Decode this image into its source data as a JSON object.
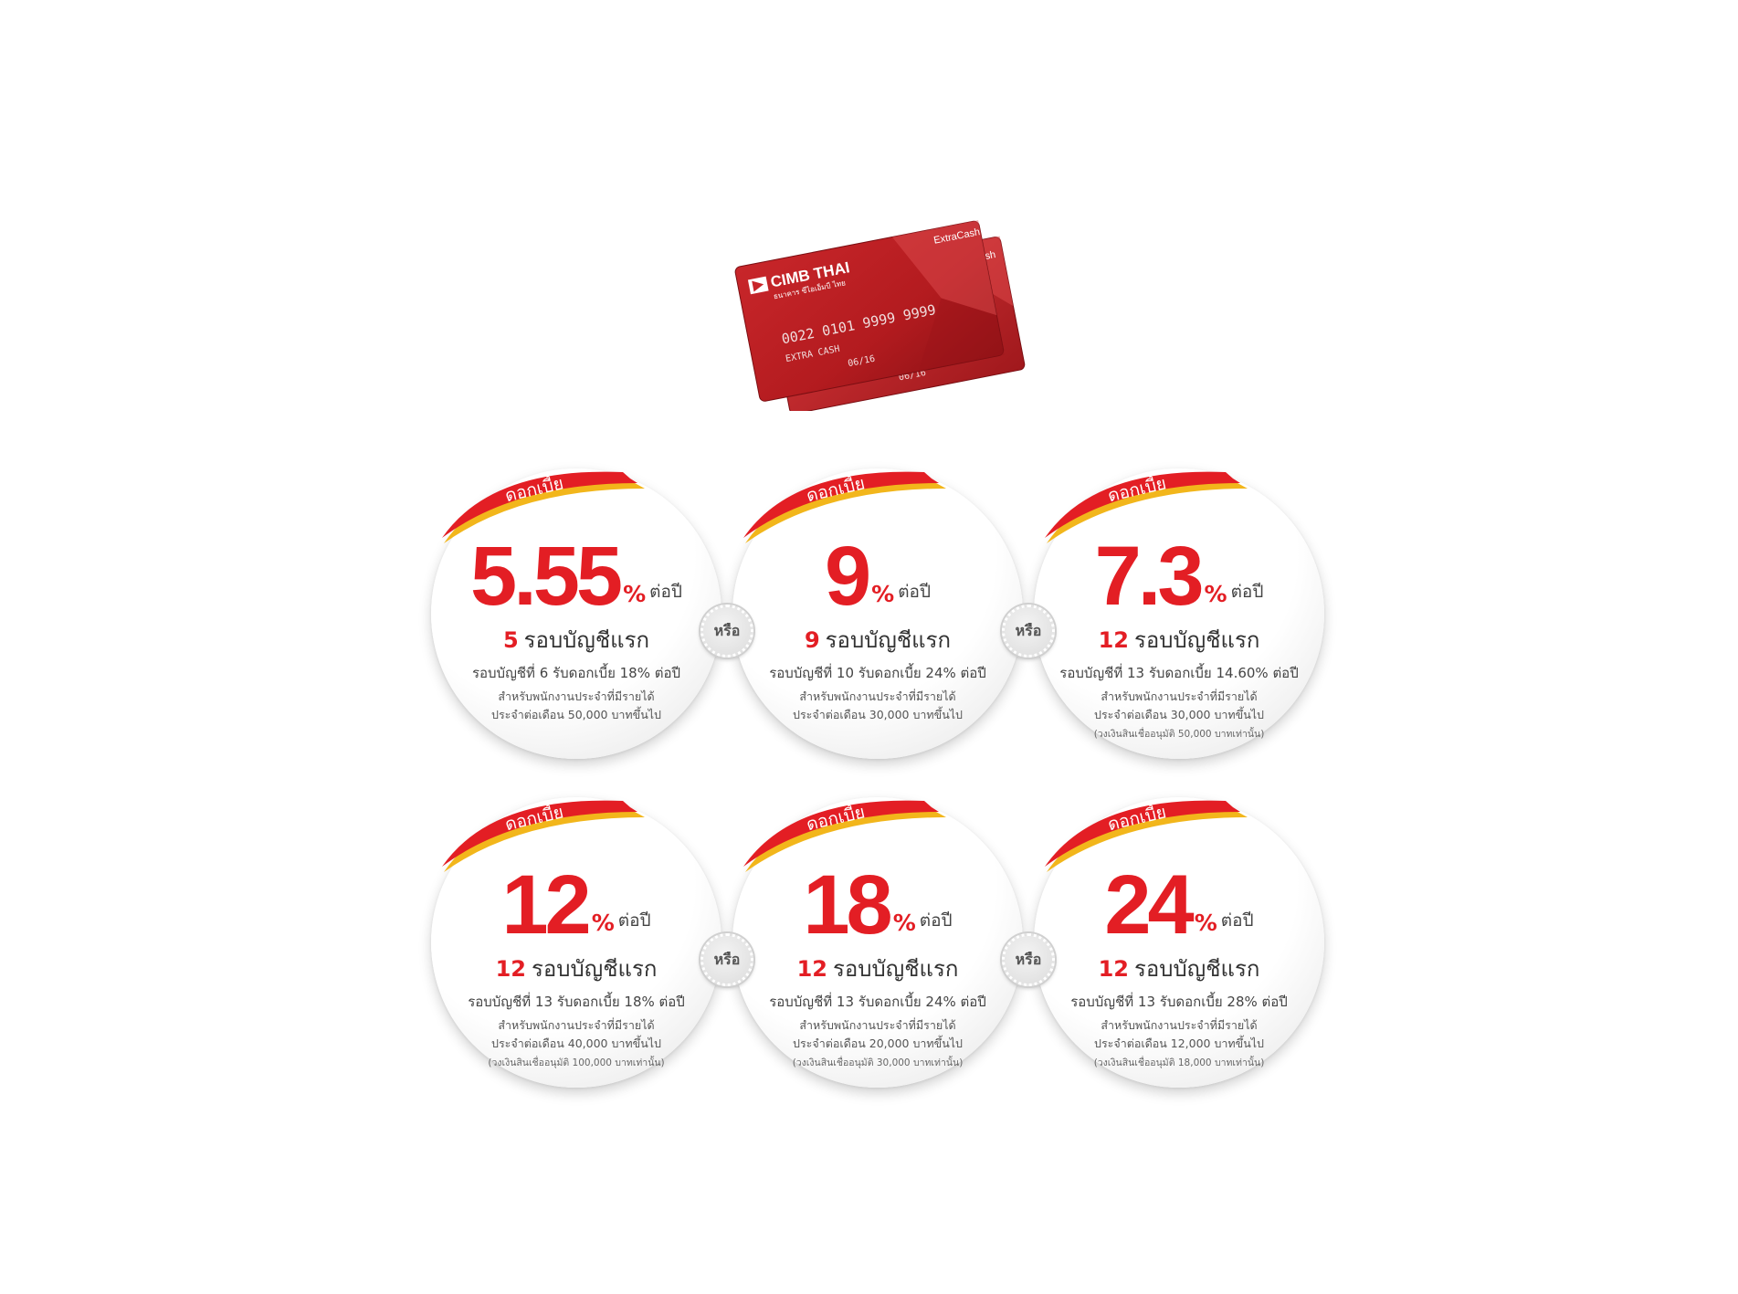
{
  "card": {
    "bank_name": "CIMB THAI",
    "bank_name_thai": "ธนาคาร ซีไอเอ็มบี ไทย",
    "product": "ExtraCash",
    "card_number": "0022 0101 9999 9999",
    "card_label": "EXTRA CASH",
    "expiry": "06/16",
    "back_product": "ash",
    "back_expiry": "06/16"
  },
  "or_label": "หรือ",
  "banner_label": "ดอกเบี้ย",
  "rate_pct": "%",
  "rate_suffix": "ต่อปี",
  "promo_suffix": "รอบบัญชีแรก",
  "offers": [
    {
      "rate": "5.55",
      "promo_count": "5",
      "after": "รอบบัญชีที่ 6 รับดอกเบี้ย 18% ต่อปี",
      "cond1": "สำหรับพนักงานประจำที่มีรายได้",
      "cond2": "ประจำต่อเดือน 50,000 บาทขึ้นไป",
      "note": ""
    },
    {
      "rate": "9",
      "promo_count": "9",
      "after": "รอบบัญชีที่ 10 รับดอกเบี้ย 24% ต่อปี",
      "cond1": "สำหรับพนักงานประจำที่มีรายได้",
      "cond2": "ประจำต่อเดือน 30,000 บาทขึ้นไป",
      "note": ""
    },
    {
      "rate": "7.3",
      "promo_count": "12",
      "after": "รอบบัญชีที่ 13 รับดอกเบี้ย 14.60% ต่อปี",
      "cond1": "สำหรับพนักงานประจำที่มีรายได้",
      "cond2": "ประจำต่อเดือน 30,000 บาทขึ้นไป",
      "note": "(วงเงินสินเชื่ออนุมัติ 50,000 บาทเท่านั้น)"
    },
    {
      "rate": "12",
      "promo_count": "12",
      "after": "รอบบัญชีที่ 13 รับดอกเบี้ย 18% ต่อปี",
      "cond1": "สำหรับพนักงานประจำที่มีรายได้",
      "cond2": "ประจำต่อเดือน 40,000 บาทขึ้นไป",
      "note": "(วงเงินสินเชื่ออนุมัติ 100,000 บาทเท่านั้น)"
    },
    {
      "rate": "18",
      "promo_count": "12",
      "after": "รอบบัญชีที่ 13 รับดอกเบี้ย 24% ต่อปี",
      "cond1": "สำหรับพนักงานประจำที่มีรายได้",
      "cond2": "ประจำต่อเดือน 20,000 บาทขึ้นไป",
      "note": "(วงเงินสินเชื่ออนุมัติ 30,000 บาทเท่านั้น)"
    },
    {
      "rate": "24",
      "promo_count": "12",
      "after": "รอบบัญชีที่ 13 รับดอกเบี้ย 28% ต่อปี",
      "cond1": "สำหรับพนักงานประจำที่มีรายได้",
      "cond2": "ประจำต่อเดือน 12,000 บาทขึ้นไป",
      "note": "(วงเงินสินเชื่ออนุมัติ 18,000 บาทเท่านั้น)"
    }
  ],
  "colors": {
    "accent_red": "#e31e24",
    "banner_gold": "#f2b61b",
    "card_red": "#b61c1f"
  }
}
